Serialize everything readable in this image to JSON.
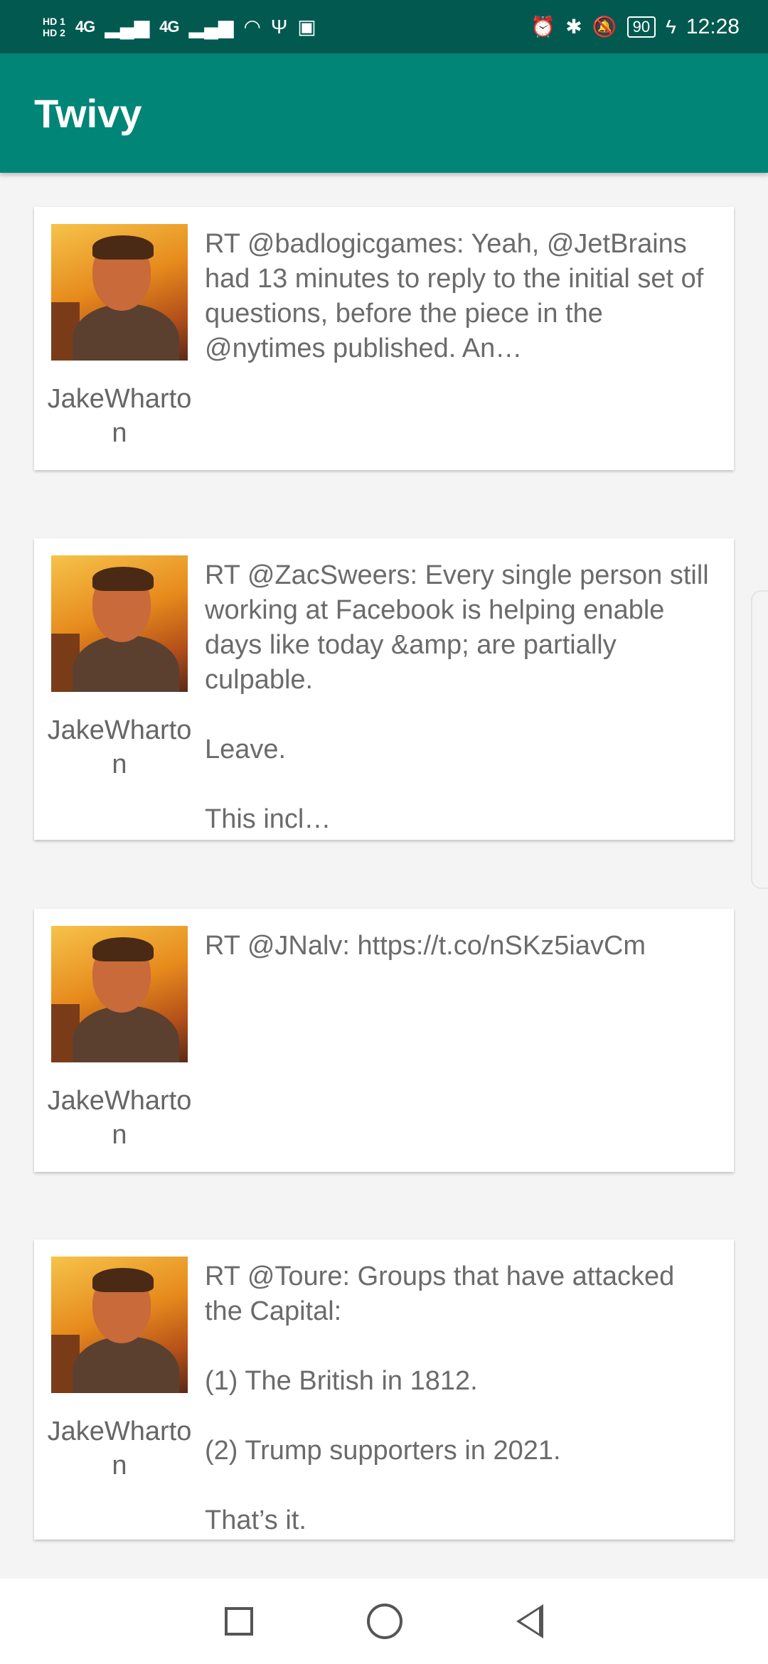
{
  "status_bar": {
    "hd1": "HD 1",
    "hd2": "HD 2",
    "network1": "4G",
    "network2": "4G",
    "battery": "90",
    "time": "12:28"
  },
  "app_bar": {
    "title": "Twivy"
  },
  "tweets": [
    {
      "username": "JakeWharton",
      "text": "RT @badlogicgames: Yeah, @JetBrains had 13 minutes to reply to the initial set of questions, before the piece in the @nytimes published. An…"
    },
    {
      "username": "JakeWharton",
      "text": "RT @ZacSweers: Every single person still working at Facebook is helping enable days like today &amp; are partially culpable.\n\nLeave.\n\nThis incl…"
    },
    {
      "username": "JakeWharton",
      "text": "RT @JNalv: https://t.co/nSKz5iavCm"
    },
    {
      "username": "JakeWharton",
      "text": "RT @Toure: Groups that have attacked the Capital:\n\n(1) The British in 1812.\n\n(2) Trump supporters in 2021.\n\nThat’s it."
    }
  ]
}
